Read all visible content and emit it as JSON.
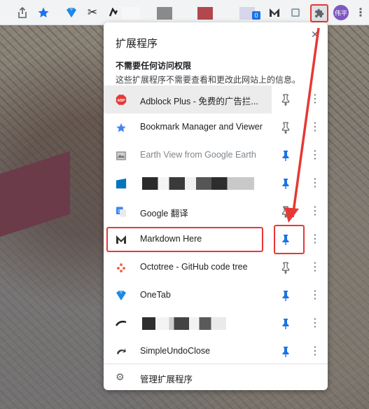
{
  "toolbar": {
    "avatar_text": "伟平",
    "badge_count": "0"
  },
  "popup": {
    "title": "扩展程序",
    "section_heading": "不需要任何访问权限",
    "section_sub": "这些扩展程序不需要查看和更改此网站上的信息。",
    "manage_label": "管理扩展程序",
    "extensions": [
      {
        "name": "Adblock Plus - 免费的广告拦...",
        "pinned": false,
        "icon": "abp-icon"
      },
      {
        "name": "Bookmark Manager and Viewer",
        "pinned": false,
        "icon": "star-icon"
      },
      {
        "name": "Earth View from Google Earth",
        "pinned": true,
        "icon": "earth-view-icon"
      },
      {
        "name": "",
        "pinned": true,
        "icon": "blurred-extension-icon"
      },
      {
        "name": "Google 翻译",
        "pinned": false,
        "icon": "google-translate-icon"
      },
      {
        "name": "Markdown Here",
        "pinned": true,
        "icon": "markdown-here-icon"
      },
      {
        "name": "Octotree - GitHub code tree",
        "pinned": false,
        "icon": "octotree-icon"
      },
      {
        "name": "OneTab",
        "pinned": true,
        "icon": "onetab-icon"
      },
      {
        "name": "",
        "pinned": true,
        "icon": "blurred-extension-icon"
      },
      {
        "name": "SimpleUndoClose",
        "pinned": true,
        "icon": "undo-icon"
      }
    ]
  },
  "colors": {
    "pin_active": "#1a73e8",
    "pin_inactive": "#5f6368",
    "annotation": "#e53935",
    "avatar": "#7e57c2"
  }
}
